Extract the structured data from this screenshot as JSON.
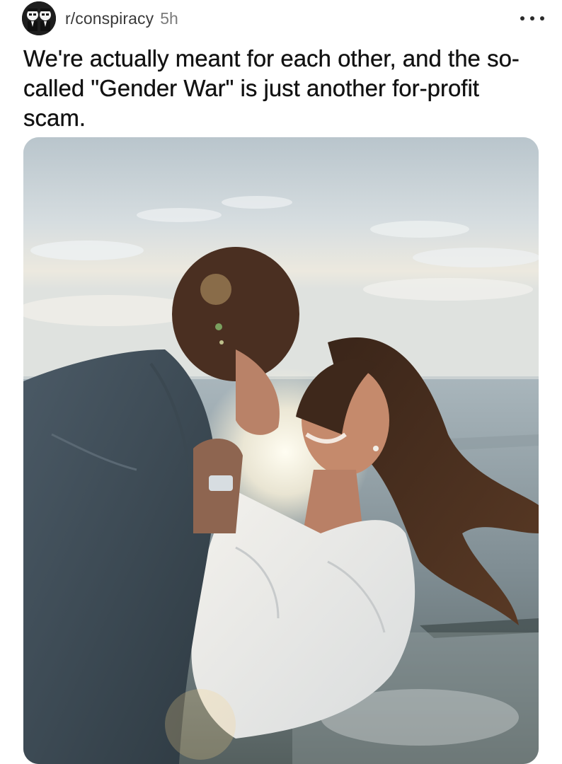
{
  "post": {
    "subreddit": "r/conspiracy",
    "age": "5h",
    "title": "We're actually meant for each other, and the so-called \"Gender War\" is just another for-profit scam.",
    "avatar_icon": "spy-duo-avatar-icon",
    "more_icon": "more-options-icon",
    "image": {
      "subject": "couple-embracing-by-sea-photo"
    }
  },
  "colors": {
    "title_text": "#111111",
    "meta_text": "#7b7b7b",
    "subreddit_text": "#3a3a3a",
    "background": "#ffffff"
  }
}
